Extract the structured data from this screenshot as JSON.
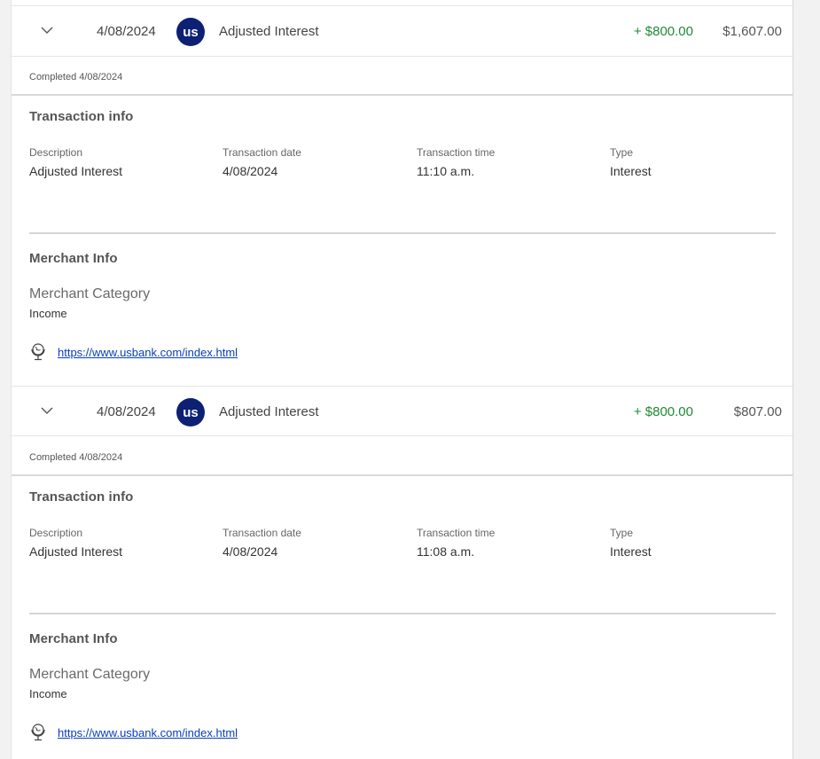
{
  "colors": {
    "credit_green": "#1f8a34",
    "link_blue": "#0a40b8",
    "logo_navy": "#0c2074"
  },
  "transactions": [
    {
      "expand_icon": "chevron-down-icon",
      "date": "4/08/2024",
      "merchant_logo_text": "us",
      "description": "Adjusted Interest",
      "amount": "+ $800.00",
      "balance": "$1,607.00",
      "status": "Completed 4/08/2024",
      "info": {
        "title": "Transaction info",
        "description_label": "Description",
        "description_value": "Adjusted Interest",
        "date_label": "Transaction date",
        "date_value": "4/08/2024",
        "time_label": "Transaction time",
        "time_value": "11:10 a.m.",
        "type_label": "Type",
        "type_value": "Interest"
      },
      "merchant": {
        "title": "Merchant Info",
        "category_label": "Merchant Category",
        "category_value": "Income",
        "website_icon": "globe-icon",
        "website": "https://www.usbank.com/index.html"
      }
    },
    {
      "expand_icon": "chevron-down-icon",
      "date": "4/08/2024",
      "merchant_logo_text": "us",
      "description": "Adjusted Interest",
      "amount": "+ $800.00",
      "balance": "$807.00",
      "status": "Completed 4/08/2024",
      "info": {
        "title": "Transaction info",
        "description_label": "Description",
        "description_value": "Adjusted Interest",
        "date_label": "Transaction date",
        "date_value": "4/08/2024",
        "time_label": "Transaction time",
        "time_value": "11:08 a.m.",
        "type_label": "Type",
        "type_value": "Interest"
      },
      "merchant": {
        "title": "Merchant Info",
        "category_label": "Merchant Category",
        "category_value": "Income",
        "website_icon": "globe-icon",
        "website": "https://www.usbank.com/index.html"
      }
    }
  ]
}
